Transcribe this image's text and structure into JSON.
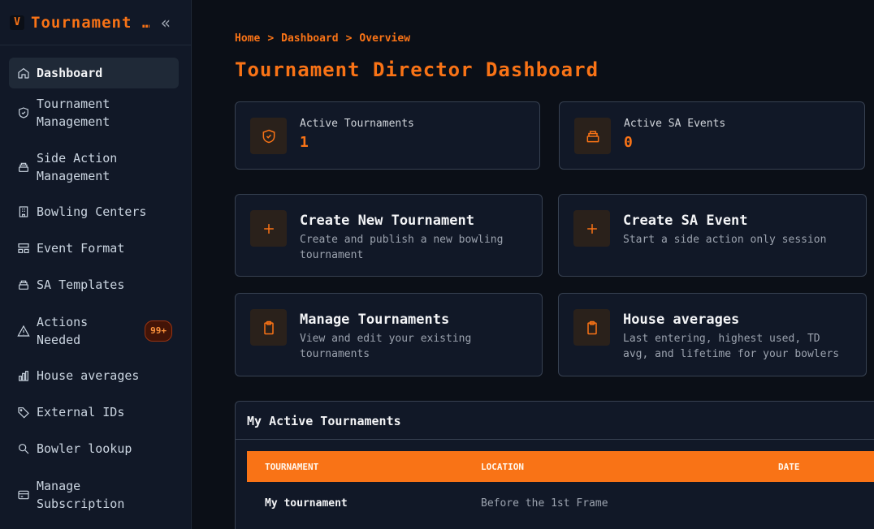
{
  "brand": {
    "logo": "V",
    "title": "Tournament …"
  },
  "nav": [
    {
      "label": "Dashboard",
      "icon": "home-icon"
    },
    {
      "label": "Tournament\nManagement",
      "icon": "shield-icon"
    },
    {
      "label": "Side Action\nManagement",
      "icon": "stack-icon"
    },
    {
      "label": "Bowling Centers",
      "icon": "building-icon"
    },
    {
      "label": "Event Format",
      "icon": "layout-icon"
    },
    {
      "label": "SA Templates",
      "icon": "stack-icon"
    },
    {
      "label": "Actions\nNeeded",
      "icon": "alert-icon",
      "badge": "99+"
    },
    {
      "label": "House averages",
      "icon": "bar-chart-icon"
    },
    {
      "label": "External IDs",
      "icon": "tag-icon"
    },
    {
      "label": "Bowler lookup",
      "icon": "search-icon"
    },
    {
      "label": "Manage\nSubscription",
      "icon": "card-icon"
    }
  ],
  "breadcrumb": [
    "Home",
    "Dashboard",
    "Overview"
  ],
  "breadcrumb_sep": ">",
  "page_title": "Tournament Director Dashboard",
  "stats": [
    {
      "label": "Active Tournaments",
      "value": "1",
      "icon": "shield-check-icon"
    },
    {
      "label": "Active SA Events",
      "value": "0",
      "icon": "stack-icon"
    }
  ],
  "actions": [
    {
      "title": "Create New Tournament",
      "desc": "Create and publish a new bowling tournament",
      "icon": "plus-icon"
    },
    {
      "title": "Create SA Event",
      "desc": "Start a side action only session",
      "icon": "plus-icon"
    },
    {
      "title": "Manage Tournaments",
      "desc": "View and edit your existing tournaments",
      "icon": "clipboard-icon"
    },
    {
      "title": "House averages",
      "desc": "Last entering, highest used, TD avg, and lifetime for your bowlers",
      "icon": "clipboard-icon"
    }
  ],
  "table": {
    "title": "My Active Tournaments",
    "headers": [
      "TOURNAMENT",
      "LOCATION",
      "DATE"
    ],
    "rows": [
      {
        "tournament": "My tournament",
        "location": "Before the 1st Frame",
        "date": ""
      }
    ]
  },
  "colors": {
    "accent": "#f97316",
    "bg": "#0b0f17",
    "panel": "#111827"
  }
}
